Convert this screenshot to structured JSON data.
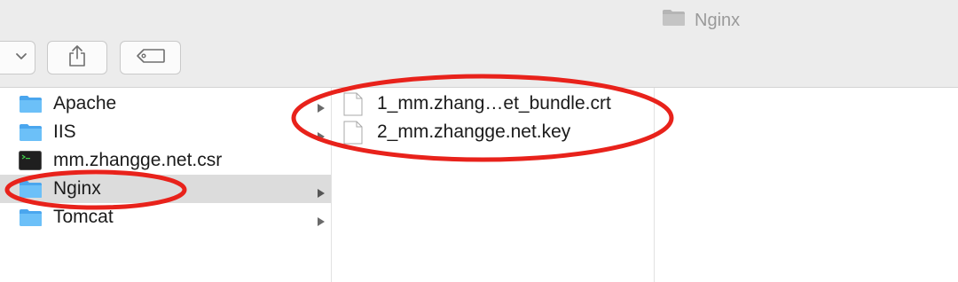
{
  "window": {
    "title": "Nginx"
  },
  "toolbar": {
    "buttons": [
      "chevron-down-icon",
      "share-icon",
      "tag-icon"
    ]
  },
  "sidebar": {
    "items": [
      {
        "label": "Apache",
        "type": "folder",
        "expandable": true
      },
      {
        "label": "IIS",
        "type": "folder",
        "expandable": true
      },
      {
        "label": "mm.zhangge.net.csr",
        "type": "terminal-file",
        "expandable": false
      },
      {
        "label": "Nginx",
        "type": "folder",
        "expandable": true,
        "selected": true
      },
      {
        "label": "Tomcat",
        "type": "folder",
        "expandable": true
      }
    ]
  },
  "contents": {
    "items": [
      {
        "label": "1_mm.zhang…et_bundle.crt",
        "type": "document"
      },
      {
        "label": "2_mm.zhangge.net.key",
        "type": "document"
      }
    ]
  },
  "colors": {
    "folder": "#5eb6f5",
    "selection": "#dcdcdc",
    "annotation": "#e8221b"
  }
}
